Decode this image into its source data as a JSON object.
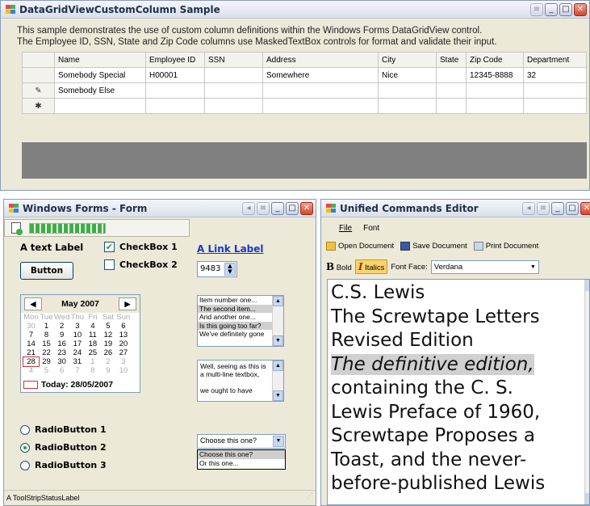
{
  "main_window": {
    "title": "DataGridViewCustomColumn Sample",
    "desc_line1": "This sample demonstrates the use of custom column definitions within the Windows Forms DataGridView control.",
    "desc_line2": "The Employee ID, SSN, State and Zip Code columns use MaskedTextBox controls for format and validate their input.",
    "grid": {
      "headers": [
        "Name",
        "Employee ID",
        "SSN",
        "Address",
        "City",
        "State",
        "Zip Code",
        "Department"
      ],
      "rows": [
        [
          "Somebody Special",
          "H00001",
          "",
          "Somewhere",
          "Nice",
          "",
          "12345-8888",
          "32"
        ],
        [
          "Somebody Else",
          "",
          "",
          "",
          "",
          "",
          "",
          ""
        ],
        [
          "",
          "",
          "",
          "",
          "",
          "",
          "",
          ""
        ]
      ],
      "row_markers": [
        "",
        "✎",
        "✱"
      ]
    }
  },
  "form_window": {
    "title": "Windows Forms - Form",
    "text_label": "A text Label",
    "checkbox1": "CheckBox 1",
    "checkbox2": "CheckBox 2",
    "link_label": "A Link Label",
    "button": "Button",
    "spin_value": "9483",
    "calendar": {
      "month": "May 2007",
      "days": [
        "Mon",
        "Tue",
        "Wed",
        "Thu",
        "Fri",
        "Sat",
        "Sun"
      ],
      "weeks": [
        [
          "30",
          "1",
          "2",
          "3",
          "4",
          "5",
          "6"
        ],
        [
          "7",
          "8",
          "9",
          "10",
          "11",
          "12",
          "13"
        ],
        [
          "14",
          "15",
          "16",
          "17",
          "18",
          "19",
          "20"
        ],
        [
          "21",
          "22",
          "23",
          "24",
          "25",
          "26",
          "27"
        ],
        [
          "28",
          "29",
          "30",
          "31",
          "1",
          "2",
          "3"
        ],
        [
          "4",
          "5",
          "6",
          "7",
          "8",
          "9",
          "10"
        ]
      ],
      "today": "Today: 28/05/2007"
    },
    "listbox": [
      "Item number one...",
      "The second item...",
      "And another one...",
      "Is this going too far?",
      "We've definitely gone"
    ],
    "textbox": {
      "line1": "Well, seeing as this is",
      "line2": "a multi-line textbox,",
      "line3": "we ought to have"
    },
    "radios": [
      "RadioButton 1",
      "RadioButton 2",
      "RadioButton 3"
    ],
    "combo": {
      "value": "Choose this one?",
      "options": [
        "Choose this one?",
        "Or this one..."
      ]
    },
    "status": "A ToolStripStatusLabel"
  },
  "editor_window": {
    "title": "Unified Commands Editor",
    "menu": [
      "File",
      "Font"
    ],
    "toolbar": {
      "open": "Open Document",
      "save": "Save Document",
      "print": "Print Document"
    },
    "format_bar": {
      "bold": "Bold",
      "italic": "Italics",
      "font_face_label": "Font Face:",
      "font_face_value": "Verdana"
    },
    "content": {
      "l1": "C.S. Lewis",
      "l2": "The Screwtape Letters",
      "l3": "Revised Edition",
      "l4": "The definitive edition,",
      "l5": "containing the C. S.",
      "l6": "Lewis Preface of 1960,",
      "l7": "Screwtape Proposes a",
      "l8": "Toast, and the never-",
      "l9": "before-published Lewis"
    }
  },
  "colors": {
    "accent": "#1838c8",
    "selection": "#d0d0d0",
    "close": "#d8452c"
  }
}
